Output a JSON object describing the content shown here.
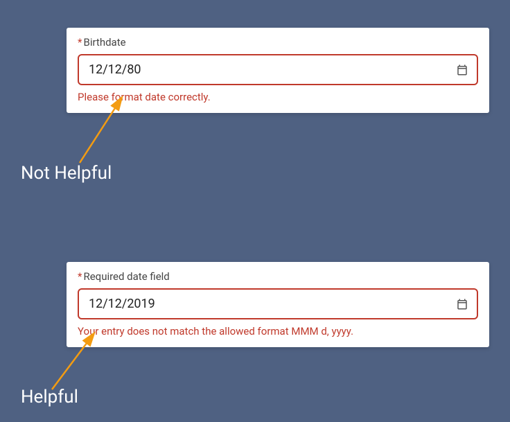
{
  "example1": {
    "label": "Birthdate",
    "required_mark": "*",
    "value": "12/12/80",
    "error": "Please format date correctly.",
    "caption": "Not Helpful"
  },
  "example2": {
    "label": "Required date field",
    "required_mark": "*",
    "value": "12/12/2019",
    "error": "Your entry does not match the allowed format MMM d, yyyy.",
    "caption": "Helpful"
  },
  "colors": {
    "background": "#4f6182",
    "error": "#c0392b",
    "arrow": "#f39c12"
  }
}
